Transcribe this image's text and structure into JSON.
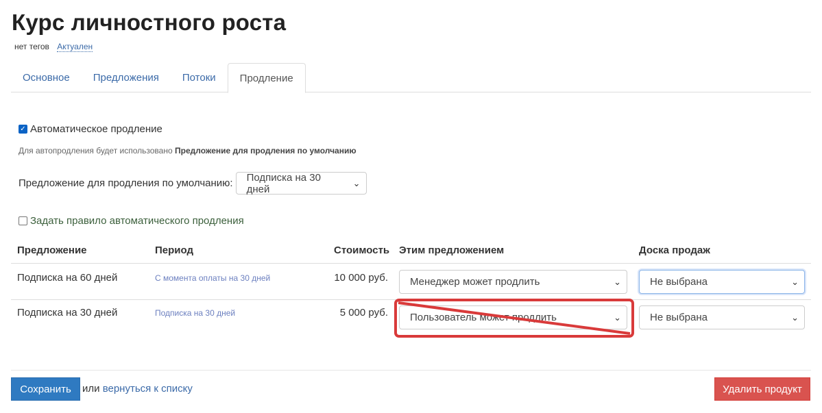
{
  "page": {
    "title": "Курс личностного роста",
    "tags": "нет тегов",
    "status": "Актуален"
  },
  "tabs": [
    {
      "label": "Основное",
      "active": false
    },
    {
      "label": "Предложения",
      "active": false
    },
    {
      "label": "Потоки",
      "active": false
    },
    {
      "label": "Продление",
      "active": true
    }
  ],
  "renewal": {
    "auto_label": "Автоматическое продление",
    "auto_checked": true,
    "note_prefix": "Для автопродления будет использовано ",
    "note_bold": "Предложение для продления по умолчанию",
    "default_label": "Предложение для продления по умолчанию:",
    "default_value": "Подписка на 30 дней",
    "rule_label": "Задать правило автоматического продления",
    "rule_checked": false
  },
  "table": {
    "headers": [
      "Предложение",
      "Период",
      "Стоимость",
      "Этим предложением",
      "Доска продаж"
    ],
    "rows": [
      {
        "offer": "Подписка на 60 дней",
        "period": "С момента оплаты на 30 дней",
        "price": "10 000 руб.",
        "renewal": "Менеджер может продлить",
        "board": "Не выбрана"
      },
      {
        "offer": "Подписка на 30 дней",
        "period": "Подписка на 30 дней",
        "price": "5 000 руб.",
        "renewal": "Пользователь может продлить",
        "board": "Не выбрана"
      }
    ]
  },
  "footer": {
    "save_label": "Сохранить",
    "or_text": "или",
    "back_label": "вернуться к списку",
    "delete_label": "Удалить продукт"
  },
  "colors": {
    "link": "#3b6aa8",
    "save": "#2f7ac1",
    "delete": "#d9534f",
    "annotation": "#d93a3a"
  }
}
